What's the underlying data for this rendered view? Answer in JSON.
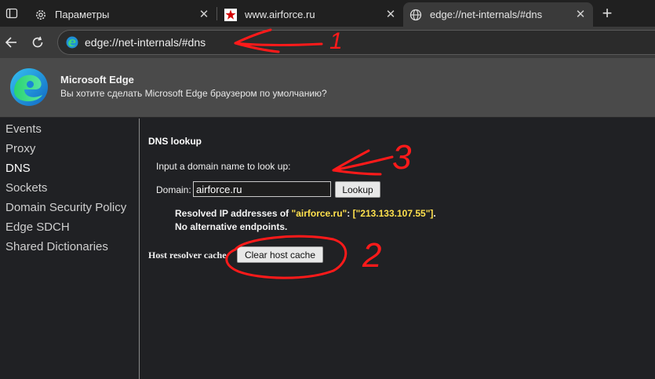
{
  "tabs": [
    {
      "title": "Параметры",
      "icon": "gear-icon",
      "active": false
    },
    {
      "title": "www.airforce.ru",
      "icon": "red-star-icon",
      "active": false
    },
    {
      "title": "edge://net-internals/#dns",
      "icon": "globe-icon",
      "active": true
    }
  ],
  "toolbar": {
    "address": "edge://net-internals/#dns"
  },
  "infobar": {
    "title": "Microsoft Edge",
    "message": "Вы хотите сделать Microsoft Edge браузером по умолчанию?"
  },
  "sidebar": {
    "items": [
      "Events",
      "Proxy",
      "DNS",
      "Sockets",
      "Domain Security Policy",
      "Edge SDCH",
      "Shared Dictionaries"
    ],
    "selected": "DNS"
  },
  "dns": {
    "heading": "DNS lookup",
    "prompt": "Input a domain name to look up:",
    "domain_label": "Domain:",
    "domain_value": "airforce.ru",
    "lookup_label": "Lookup",
    "result_prefix": "Resolved IP addresses of ",
    "result_domain": "\"airforce.ru\"",
    "result_colon": ": ",
    "result_ips": "[\"213.133.107.55\"]",
    "result_suffix": ".",
    "result_line2": "No alternative endpoints.",
    "host_cache_label": "Host resolver cache",
    "clear_cache_label": "Clear host cache"
  },
  "annotations": {
    "color": "#ff1a1a",
    "numbers": [
      "1",
      "2",
      "3"
    ]
  },
  "colors": {
    "highlight": "#ffe14d",
    "tab_active_bg": "#3a3a3a"
  }
}
